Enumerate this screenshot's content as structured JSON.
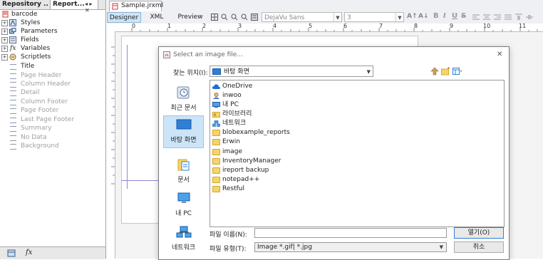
{
  "left_panel": {
    "tabs": [
      {
        "label": "Repository ..."
      },
      {
        "label": "Report..."
      }
    ],
    "tab_controls": "◂ ▸ ✕",
    "root": "barcode",
    "nodes": [
      {
        "label": "Styles",
        "icon": "styles-icon"
      },
      {
        "label": "Parameters",
        "icon": "parameters-icon"
      },
      {
        "label": "Fields",
        "icon": "fields-icon"
      },
      {
        "label": "Variables",
        "icon": "variables-icon"
      },
      {
        "label": "Scriptlets",
        "icon": "scriptlets-icon"
      }
    ],
    "bands": [
      {
        "label": "Title",
        "active": true
      },
      {
        "label": "Page Header",
        "active": false
      },
      {
        "label": "Column Header",
        "active": false
      },
      {
        "label": "Detail",
        "active": false
      },
      {
        "label": "Column Footer",
        "active": false
      },
      {
        "label": "Page Footer",
        "active": false
      },
      {
        "label": "Last Page Footer",
        "active": false
      },
      {
        "label": "Summary",
        "active": false
      },
      {
        "label": "No Data",
        "active": false
      },
      {
        "label": "Background",
        "active": false
      }
    ]
  },
  "editor": {
    "file_tab": "Sample.jrxml",
    "mode_tabs": [
      "Designer",
      "XML",
      "Preview"
    ],
    "font_name": "DejaVu Sans",
    "font_size": "3",
    "ruler_numbers": [
      "0",
      "1",
      "2",
      "3",
      "4",
      "5",
      "6",
      "7",
      "8",
      "9",
      "10",
      "11"
    ]
  },
  "dialog": {
    "title": "Select an image file...",
    "look_in_label": "찾는 위치(I):",
    "look_in_value": "바탕 화면",
    "places": [
      {
        "label": "최근 문서",
        "icon": "recent-documents-icon"
      },
      {
        "label": "바탕 화면",
        "icon": "desktop-icon"
      },
      {
        "label": "문서",
        "icon": "documents-icon"
      },
      {
        "label": "내 PC",
        "icon": "computer-icon"
      },
      {
        "label": "네트워크",
        "icon": "network-icon"
      }
    ],
    "files": [
      {
        "name": "OneDrive",
        "icon": "cloud-icon"
      },
      {
        "name": "inwoo",
        "icon": "user-folder-icon"
      },
      {
        "name": "내 PC",
        "icon": "computer-icon"
      },
      {
        "name": "라이브러리",
        "icon": "library-icon"
      },
      {
        "name": "네트워크",
        "icon": "network-icon"
      },
      {
        "name": "blobexample_reports",
        "icon": "folder-icon"
      },
      {
        "name": "Erwin",
        "icon": "folder-icon"
      },
      {
        "name": "image",
        "icon": "folder-icon"
      },
      {
        "name": "InventoryManager",
        "icon": "folder-icon"
      },
      {
        "name": "ireport backup",
        "icon": "folder-icon"
      },
      {
        "name": "notepad++",
        "icon": "folder-icon"
      },
      {
        "name": "Restful",
        "icon": "folder-icon"
      }
    ],
    "filename_label": "파일 이름(N):",
    "filename_value": "",
    "filetype_label": "파일 유형(T):",
    "filetype_value": "Image *.gif| *.jpg",
    "open_button": "열기(O)",
    "cancel_button": "취소",
    "close_glyph": "✕"
  },
  "colors": {
    "accent": "#2f7fd6",
    "folder": "#f5d46c",
    "selected": "#cce4f7"
  }
}
